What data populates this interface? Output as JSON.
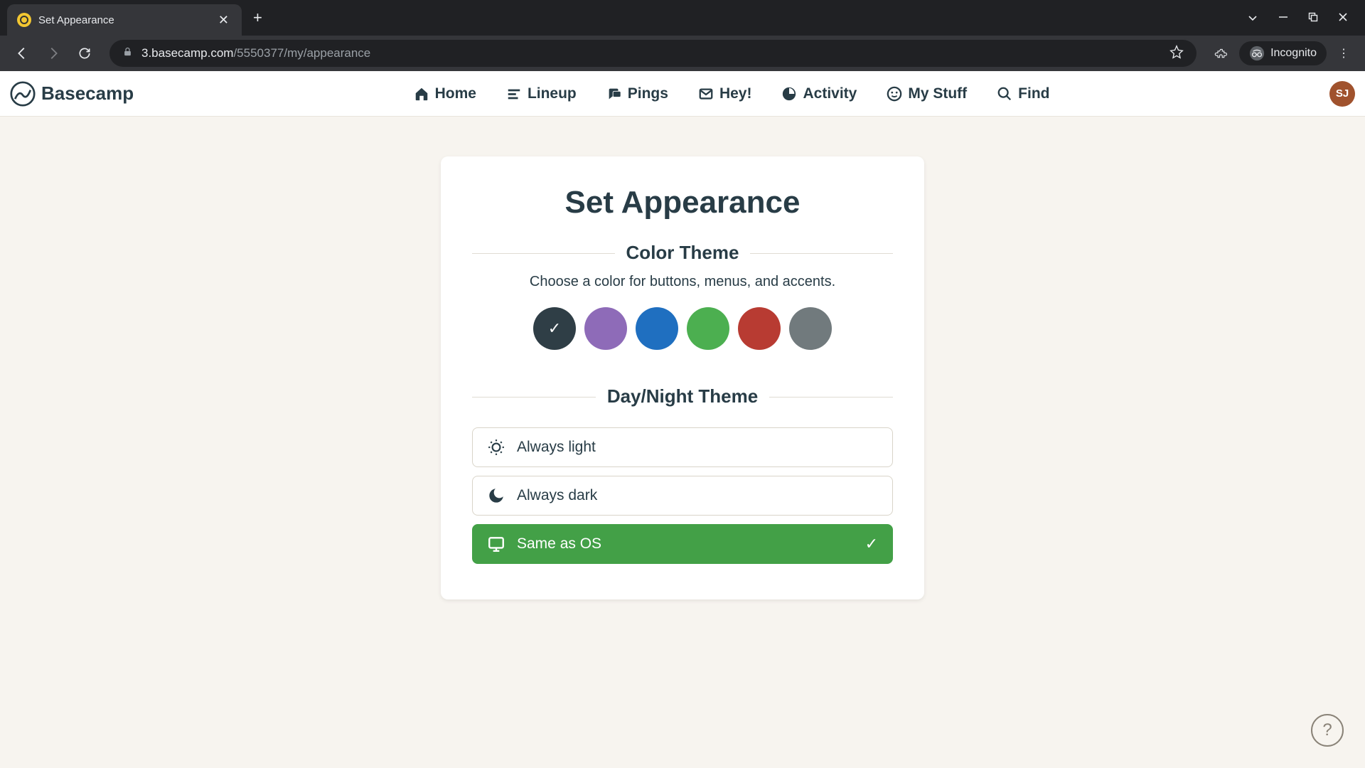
{
  "browser": {
    "tab_title": "Set Appearance",
    "url_domain": "3.basecamp.com",
    "url_path": "/5550377/my/appearance",
    "incognito_label": "Incognito"
  },
  "app": {
    "brand": "Basecamp",
    "nav": [
      {
        "label": "Home"
      },
      {
        "label": "Lineup"
      },
      {
        "label": "Pings"
      },
      {
        "label": "Hey!"
      },
      {
        "label": "Activity"
      },
      {
        "label": "My Stuff"
      },
      {
        "label": "Find"
      }
    ],
    "avatar_initials": "SJ"
  },
  "page": {
    "title": "Set Appearance",
    "color_theme": {
      "heading": "Color Theme",
      "description": "Choose a color for buttons, menus, and accents.",
      "swatches": [
        {
          "name": "dark",
          "color": "#2f3e46",
          "selected": true
        },
        {
          "name": "purple",
          "color": "#8e6bb8",
          "selected": false
        },
        {
          "name": "blue",
          "color": "#1f6fc0",
          "selected": false
        },
        {
          "name": "green",
          "color": "#4caf50",
          "selected": false
        },
        {
          "name": "red",
          "color": "#b83b32",
          "selected": false
        },
        {
          "name": "gray",
          "color": "#717a7d",
          "selected": false
        }
      ]
    },
    "day_night": {
      "heading": "Day/Night Theme",
      "options": [
        {
          "id": "light",
          "label": "Always light",
          "selected": false
        },
        {
          "id": "dark",
          "label": "Always dark",
          "selected": false
        },
        {
          "id": "os",
          "label": "Same as OS",
          "selected": true
        }
      ]
    }
  },
  "help_label": "?"
}
